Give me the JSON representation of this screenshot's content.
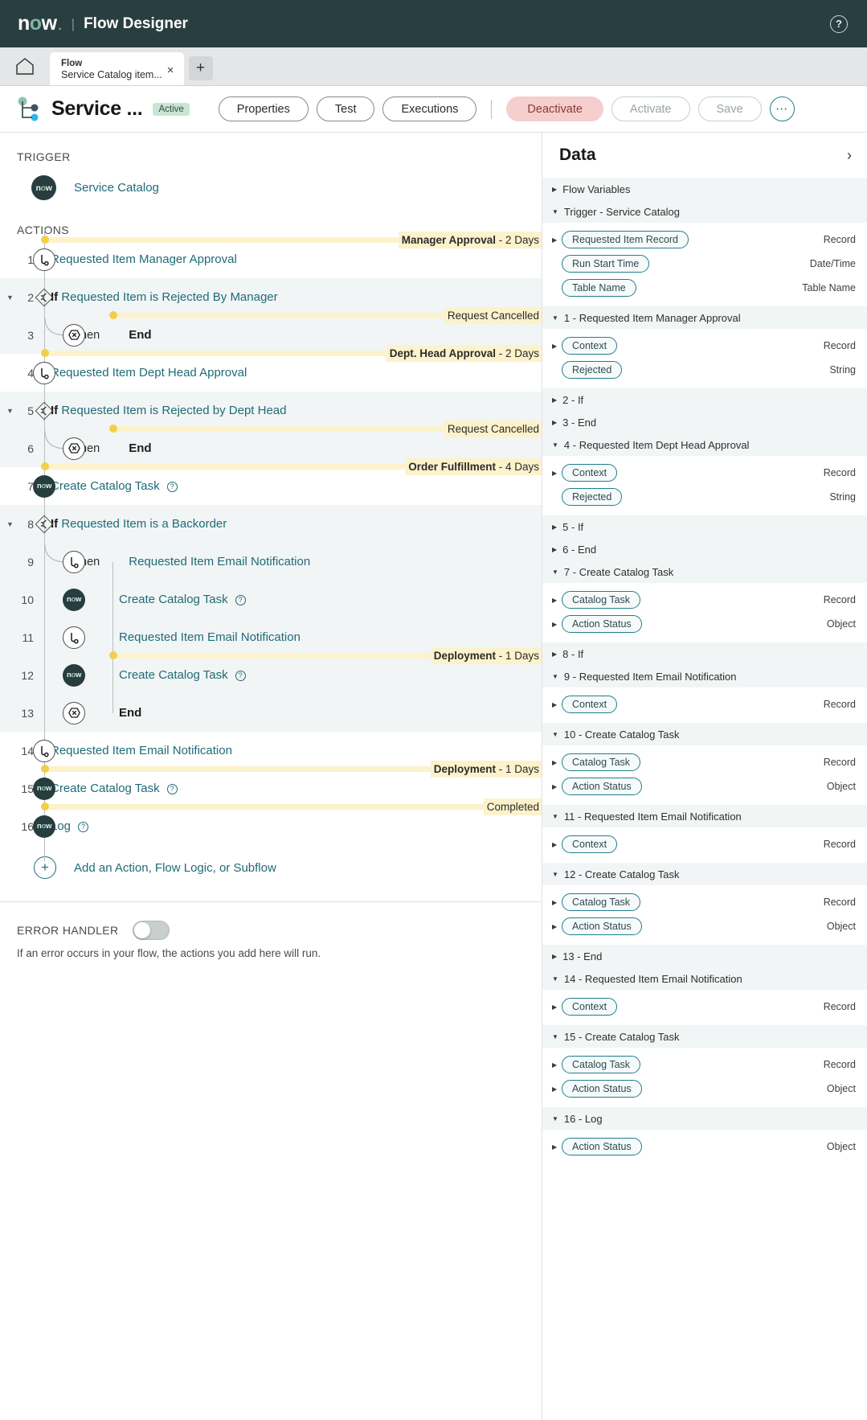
{
  "topbar": {
    "brand": "now",
    "brand_dot": ".",
    "divider": "|",
    "app_title": "Flow Designer",
    "help_icon": "?"
  },
  "tabbar": {
    "home_icon": "home-icon",
    "tab": {
      "kind": "Flow",
      "name": "Service Catalog item...",
      "close": "×"
    },
    "add": "+"
  },
  "flowheader": {
    "title": "Service ...",
    "status_badge": "Active",
    "buttons": {
      "properties": "Properties",
      "test": "Test",
      "executions": "Executions",
      "deactivate": "Deactivate",
      "activate": "Activate",
      "save": "Save",
      "more": "•••"
    },
    "accent_teal": "#1f7f8c",
    "deactivate_bg": "#f4cfcd",
    "badge_bg": "#c9e5d4"
  },
  "canvas": {
    "trigger_section": "TRIGGER",
    "actions_section": "ACTIONS",
    "trigger": {
      "icon": "now-logo-icon",
      "label": "Service Catalog"
    },
    "add_action": {
      "icon": "plus-icon",
      "label": "Add an Action, Flow Logic, or Subflow"
    },
    "error_handler": {
      "title": "ERROR HANDLER",
      "toggle_state": "off",
      "description": "If an error occurs in your flow, the actions you add here will run."
    },
    "steps": [
      {
        "num": "1",
        "icon": "approval-icon",
        "label": "Requested Item Manager Approval",
        "type": "link",
        "indent": 0,
        "caret": false,
        "highlight": false,
        "annotation": {
          "name": "Manager Approval",
          "detail": " - 2 Days"
        }
      },
      {
        "num": "2",
        "icon": "flow-logic-icon",
        "label": "Requested Item is Rejected By Manager",
        "type": "if",
        "prefix": "If",
        "indent": 0,
        "caret": true,
        "highlight": true,
        "annotation": null
      },
      {
        "num": "3",
        "icon": "end-icon",
        "label": "End",
        "type": "end",
        "then": "then",
        "indent": 1,
        "caret": false,
        "highlight": true,
        "annotation": {
          "name": "",
          "detail": "Request Cancelled"
        }
      },
      {
        "num": "4",
        "icon": "approval-icon",
        "label": "Requested Item Dept Head Approval",
        "type": "link",
        "indent": 0,
        "caret": false,
        "highlight": false,
        "annotation": {
          "name": "Dept. Head Approval",
          "detail": " - 2 Days"
        }
      },
      {
        "num": "5",
        "icon": "flow-logic-icon",
        "label": "Requested Item is Rejected by Dept Head",
        "type": "if",
        "prefix": "If",
        "indent": 0,
        "caret": true,
        "highlight": true,
        "annotation": null
      },
      {
        "num": "6",
        "icon": "end-icon",
        "label": "End",
        "type": "end",
        "then": "then",
        "indent": 1,
        "caret": false,
        "highlight": true,
        "annotation": {
          "name": "",
          "detail": "Request Cancelled"
        }
      },
      {
        "num": "7",
        "icon": "now-logo-icon",
        "label": "Create Catalog Task",
        "type": "now",
        "help": true,
        "indent": 0,
        "caret": false,
        "highlight": false,
        "annotation": {
          "name": "Order Fulfillment",
          "detail": " - 4 Days"
        }
      },
      {
        "num": "8",
        "icon": "flow-logic-icon",
        "label": "Requested Item is a Backorder",
        "type": "if",
        "prefix": "If",
        "indent": 0,
        "caret": true,
        "highlight": true,
        "annotation": null
      },
      {
        "num": "9",
        "icon": "approval-icon",
        "label": "Requested Item Email Notification",
        "type": "link",
        "then": "then",
        "indent": 1,
        "caret": false,
        "highlight": true,
        "annotation": null
      },
      {
        "num": "10",
        "icon": "now-logo-icon",
        "label": "Create Catalog Task",
        "type": "now",
        "help": true,
        "indent": 1,
        "caret": false,
        "highlight": true,
        "annotation": null
      },
      {
        "num": "11",
        "icon": "approval-icon",
        "label": "Requested Item Email Notification",
        "type": "link",
        "indent": 1,
        "caret": false,
        "highlight": true,
        "annotation": null
      },
      {
        "num": "12",
        "icon": "now-logo-icon",
        "label": "Create Catalog Task",
        "type": "now",
        "help": true,
        "indent": 1,
        "caret": false,
        "highlight": true,
        "annotation": {
          "name": "Deployment",
          "detail": " - 1 Days"
        }
      },
      {
        "num": "13",
        "icon": "end-icon",
        "label": "End",
        "type": "end",
        "indent": 1,
        "caret": false,
        "highlight": true,
        "annotation": null
      },
      {
        "num": "14",
        "icon": "approval-icon",
        "label": "Requested Item Email Notification",
        "type": "link",
        "indent": 0,
        "caret": false,
        "highlight": false,
        "annotation": null
      },
      {
        "num": "15",
        "icon": "now-logo-icon",
        "label": "Create Catalog Task",
        "type": "now",
        "help": true,
        "indent": 0,
        "caret": false,
        "highlight": false,
        "annotation": {
          "name": "Deployment",
          "detail": " - 1 Days"
        }
      },
      {
        "num": "16",
        "icon": "now-logo-icon",
        "label": "Log",
        "type": "now",
        "help": true,
        "indent": 0,
        "caret": false,
        "highlight": false,
        "annotation": {
          "name": "",
          "detail": "Completed"
        }
      }
    ]
  },
  "datapanel": {
    "title": "Data",
    "collapse_icon": "chevron-right-icon",
    "groups": [
      {
        "label": "Flow Variables",
        "expanded": false,
        "rows": []
      },
      {
        "label": "Trigger - Service Catalog",
        "expanded": true,
        "rows": [
          {
            "name": "Requested Item Record",
            "type": "Record",
            "expandable": true
          },
          {
            "name": "Run Start Time",
            "type": "Date/Time",
            "expandable": false
          },
          {
            "name": "Table Name",
            "type": "Table Name",
            "expandable": false
          }
        ]
      },
      {
        "label": "1 - Requested Item Manager Approval",
        "expanded": true,
        "rows": [
          {
            "name": "Context",
            "type": "Record",
            "expandable": true
          },
          {
            "name": "Rejected",
            "type": "String",
            "expandable": false
          }
        ]
      },
      {
        "label": "2 - If",
        "expanded": false,
        "rows": []
      },
      {
        "label": "3 - End",
        "expanded": false,
        "rows": []
      },
      {
        "label": "4 - Requested Item Dept Head Approval",
        "expanded": true,
        "rows": [
          {
            "name": "Context",
            "type": "Record",
            "expandable": true
          },
          {
            "name": "Rejected",
            "type": "String",
            "expandable": false
          }
        ]
      },
      {
        "label": "5 - If",
        "expanded": false,
        "rows": []
      },
      {
        "label": "6 - End",
        "expanded": false,
        "rows": []
      },
      {
        "label": "7 - Create Catalog Task",
        "expanded": true,
        "rows": [
          {
            "name": "Catalog Task",
            "type": "Record",
            "expandable": true
          },
          {
            "name": "Action Status",
            "type": "Object",
            "expandable": true
          }
        ]
      },
      {
        "label": "8 - If",
        "expanded": false,
        "rows": []
      },
      {
        "label": "9 - Requested Item Email Notification",
        "expanded": true,
        "rows": [
          {
            "name": "Context",
            "type": "Record",
            "expandable": true
          }
        ]
      },
      {
        "label": "10 - Create Catalog Task",
        "expanded": true,
        "rows": [
          {
            "name": "Catalog Task",
            "type": "Record",
            "expandable": true
          },
          {
            "name": "Action Status",
            "type": "Object",
            "expandable": true
          }
        ]
      },
      {
        "label": "11 - Requested Item Email Notification",
        "expanded": true,
        "rows": [
          {
            "name": "Context",
            "type": "Record",
            "expandable": true
          }
        ]
      },
      {
        "label": "12 - Create Catalog Task",
        "expanded": true,
        "rows": [
          {
            "name": "Catalog Task",
            "type": "Record",
            "expandable": true
          },
          {
            "name": "Action Status",
            "type": "Object",
            "expandable": true
          }
        ]
      },
      {
        "label": "13 - End",
        "expanded": false,
        "rows": []
      },
      {
        "label": "14 - Requested Item Email Notification",
        "expanded": true,
        "rows": [
          {
            "name": "Context",
            "type": "Record",
            "expandable": true
          }
        ]
      },
      {
        "label": "15 - Create Catalog Task",
        "expanded": true,
        "rows": [
          {
            "name": "Catalog Task",
            "type": "Record",
            "expandable": true
          },
          {
            "name": "Action Status",
            "type": "Object",
            "expandable": true
          }
        ]
      },
      {
        "label": "16 - Log",
        "expanded": true,
        "rows": [
          {
            "name": "Action Status",
            "type": "Object",
            "expandable": true
          }
        ]
      }
    ]
  }
}
